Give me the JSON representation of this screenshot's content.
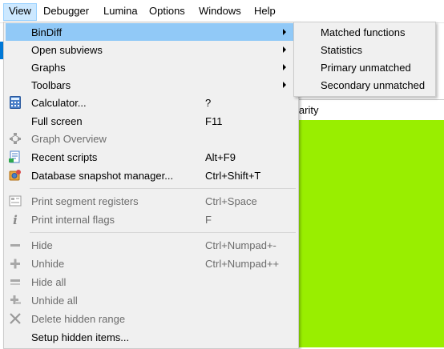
{
  "menubar": {
    "items": [
      {
        "label": "View"
      },
      {
        "label": "Debugger"
      },
      {
        "label": "Lumina"
      },
      {
        "label": "Options"
      },
      {
        "label": "Windows"
      },
      {
        "label": "Help"
      }
    ]
  },
  "view_menu": {
    "items": [
      {
        "label": "BinDiff",
        "shortcut": "",
        "icon": "none",
        "submenu": true,
        "enabled": true,
        "highlighted": true
      },
      {
        "label": "Open subviews",
        "shortcut": "",
        "icon": "none",
        "submenu": true,
        "enabled": true
      },
      {
        "label": "Graphs",
        "shortcut": "",
        "icon": "none",
        "submenu": true,
        "enabled": true
      },
      {
        "label": "Toolbars",
        "shortcut": "",
        "icon": "none",
        "submenu": true,
        "enabled": true
      },
      {
        "label": "Calculator...",
        "shortcut": "?",
        "icon": "calculator-icon",
        "enabled": true
      },
      {
        "label": "Full screen",
        "shortcut": "F11",
        "icon": "none",
        "enabled": true
      },
      {
        "label": "Graph Overview",
        "shortcut": "",
        "icon": "graph-overview-icon",
        "enabled": false
      },
      {
        "label": "Recent scripts",
        "shortcut": "Alt+F9",
        "icon": "recent-scripts-icon",
        "enabled": true
      },
      {
        "label": "Database snapshot manager...",
        "shortcut": "Ctrl+Shift+T",
        "icon": "snapshot-manager-icon",
        "enabled": true
      },
      {
        "label": "Print segment registers",
        "shortcut": "Ctrl+Space",
        "icon": "segment-registers-icon",
        "enabled": false
      },
      {
        "label": "Print internal flags",
        "shortcut": "F",
        "icon": "info-icon",
        "enabled": false
      },
      {
        "label": "Hide",
        "shortcut": "Ctrl+Numpad+-",
        "icon": "minus-icon",
        "enabled": false
      },
      {
        "label": "Unhide",
        "shortcut": "Ctrl+Numpad++",
        "icon": "plus-icon",
        "enabled": false
      },
      {
        "label": "Hide all",
        "shortcut": "",
        "icon": "minus-icon",
        "enabled": false
      },
      {
        "label": "Unhide all",
        "shortcut": "",
        "icon": "plus-icon",
        "enabled": false
      },
      {
        "label": "Delete hidden range",
        "shortcut": "",
        "icon": "close-icon",
        "enabled": false
      },
      {
        "label": "Setup hidden items...",
        "shortcut": "",
        "icon": "none",
        "enabled": true
      }
    ]
  },
  "bindiff_submenu": {
    "items": [
      {
        "label": "Matched functions"
      },
      {
        "label": "Statistics"
      },
      {
        "label": "Primary unmatched"
      },
      {
        "label": "Secondary unmatched"
      }
    ]
  },
  "background": {
    "panel_header_fragment": "larity"
  },
  "colors": {
    "menu_bg": "#f0f0f0",
    "highlight": "#91c9f7",
    "active_menubar": "#cce8ff",
    "green_panel": "#99ee00",
    "disabled_text": "#6d6d6d"
  }
}
